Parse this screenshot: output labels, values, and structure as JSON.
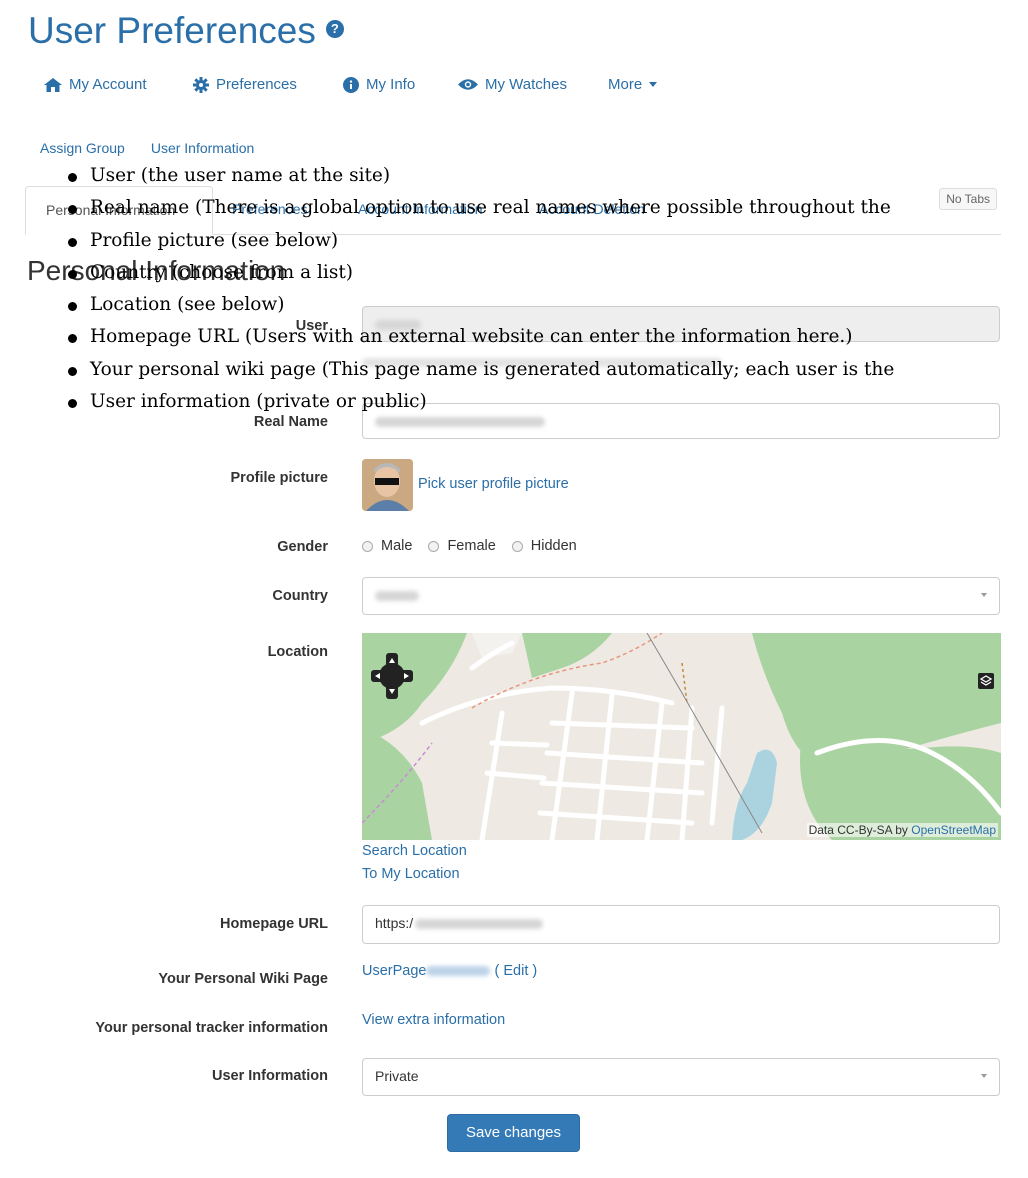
{
  "header": {
    "title": "User Preferences",
    "help_icon": "question-circle-icon"
  },
  "nav": {
    "items": [
      {
        "label": "My Account",
        "icon": "home-icon"
      },
      {
        "label": "Preferences",
        "icon": "gear-icon"
      },
      {
        "label": "My Info",
        "icon": "info-circle-icon"
      },
      {
        "label": "My Watches",
        "icon": "eye-icon"
      },
      {
        "label": "More",
        "icon": "caret-down-icon"
      }
    ]
  },
  "sublinks": [
    "Assign Group",
    "User Information"
  ],
  "tabs": {
    "items": [
      "Personal Information",
      "Preferences",
      "Account Information",
      "Account Deletion"
    ],
    "active": "Personal Information",
    "no_tabs_label": "No Tabs"
  },
  "section_title": "Personal Information",
  "bullets": [
    "User (the user name at the site)",
    "Real name (There is a global option to use real names where possible throughout the",
    "Profile picture (see below)",
    "Country (choose from a list)",
    "Location (see below)",
    "Homepage URL (Users with an external website can enter the information here.)",
    "Your personal wiki page (This page name is generated automatically; each user is the",
    "User information (private or public)"
  ],
  "form": {
    "user": {
      "label": "User"
    },
    "real_name": {
      "label": "Real Name"
    },
    "profile_picture": {
      "label": "Profile picture",
      "link": "Pick user profile picture"
    },
    "gender": {
      "label": "Gender",
      "options": [
        "Male",
        "Female",
        "Hidden"
      ]
    },
    "country": {
      "label": "Country"
    },
    "location": {
      "label": "Location",
      "search_link": "Search Location",
      "my_location_link": "To My Location",
      "attribution_prefix": "Data CC-By-SA by",
      "attribution_link": "OpenStreetMap"
    },
    "homepage": {
      "label": "Homepage URL",
      "value_prefix": "https:/"
    },
    "wiki_page": {
      "label": "Your Personal Wiki Page",
      "value_prefix": "UserPage",
      "edit_link": "Edit"
    },
    "tracker": {
      "label": "Your personal tracker information",
      "link": "View extra information"
    },
    "user_information": {
      "label": "User Information",
      "value": "Private"
    },
    "save_label": "Save changes"
  },
  "colors": {
    "accent": "#2a6fa8",
    "primary_button": "#337ab7"
  }
}
